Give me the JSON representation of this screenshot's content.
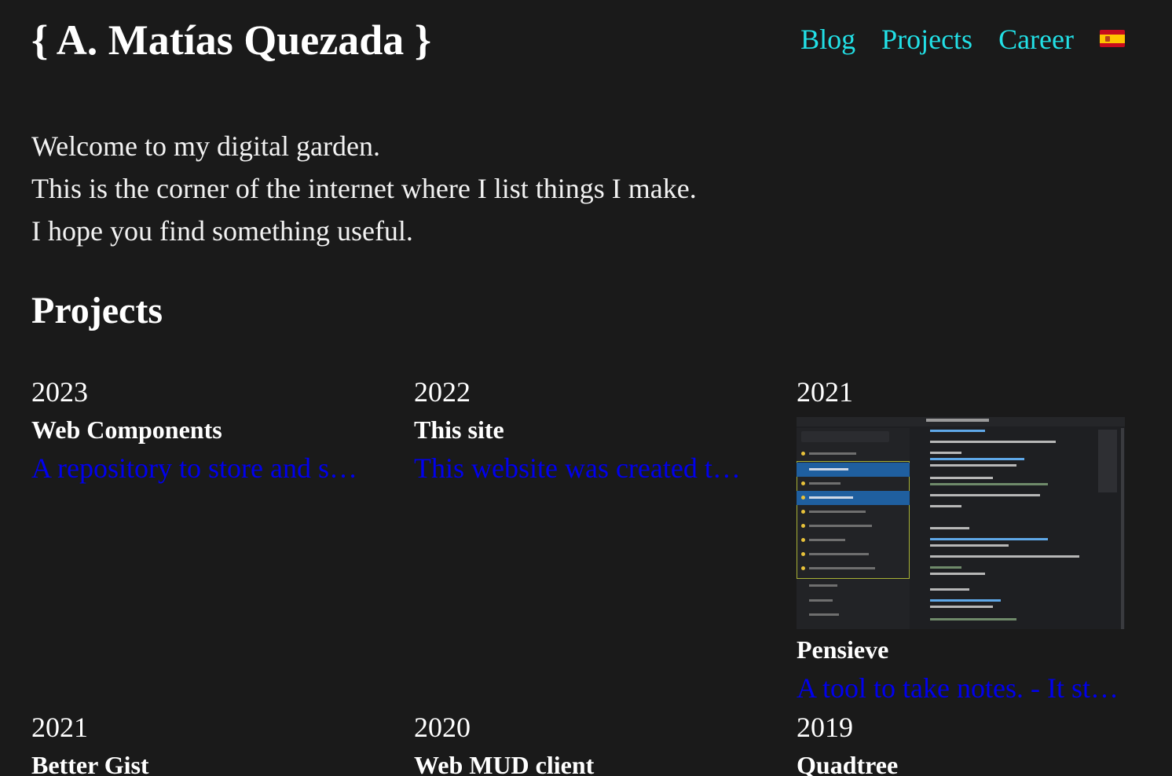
{
  "header": {
    "site_title": "{ A. Matías Quezada }",
    "nav": {
      "blog": "Blog",
      "projects": "Projects",
      "career": "Career"
    },
    "language_flag": "flag-es-icon"
  },
  "intro": {
    "line1": "Welcome to my digital garden.",
    "line2": "This is the corner of the internet where I list things I make.",
    "line3": "I hope you find something useful."
  },
  "projects": {
    "title": "Projects",
    "items": [
      {
        "year": "2023",
        "name": "Web Components",
        "description": "A repository to store and share web components"
      },
      {
        "year": "2022",
        "name": "This site",
        "description": "This website was created to list my projects"
      },
      {
        "year": "2021",
        "name": "Pensieve",
        "description": "A tool to take notes. - It stores notes locally"
      },
      {
        "year": "2021",
        "name": "Better Gist",
        "description": ""
      },
      {
        "year": "2020",
        "name": "Web MUD client",
        "description": ""
      },
      {
        "year": "2019",
        "name": "Quadtree",
        "description": ""
      }
    ]
  },
  "colors": {
    "background": "#1a1a1a",
    "link": "#22e0e6",
    "text": "#f2f2f2"
  }
}
